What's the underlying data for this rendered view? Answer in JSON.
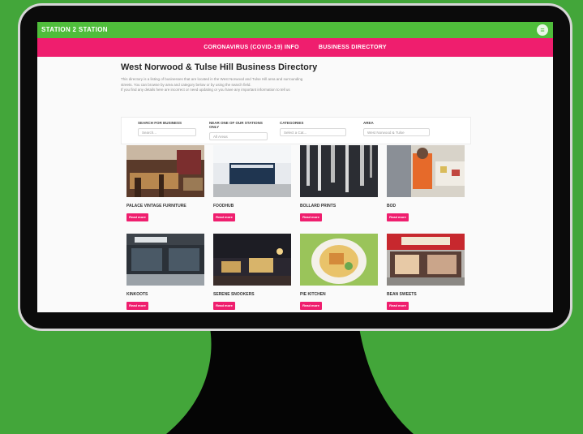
{
  "site": {
    "logo": "STATION 2 STATION",
    "menu_icon": "hamburger-circle-icon",
    "nav": [
      "CORONAVIRUS (COVID-19) INFO",
      "BUSINESS DIRECTORY"
    ]
  },
  "page": {
    "title": "West Norwood & Tulse Hill Business Directory",
    "intro_lines": [
      "This directory is a listing of businesses that are located in the West Norwood and Tulse Hill area and surrounding",
      "streets. You can browse by area and category below or by using the search field.",
      "If you find any details here are incorrect or need updating or you have any important information to tell us"
    ]
  },
  "filters": [
    {
      "label": "SEARCH FOR BUSINESS",
      "placeholder": "Search..."
    },
    {
      "label": "NEAR ONE OF OUR STATIONS ONLY",
      "placeholder": "All Areas"
    },
    {
      "label": "CATEGORIES",
      "placeholder": "Select a Cat..."
    },
    {
      "label": "AREA",
      "placeholder": "West Norwood & Tulse"
    }
  ],
  "button_label": "Read more",
  "cards": [
    {
      "name": "PALACE VINTAGE FURNITURE"
    },
    {
      "name": "FOODHUB"
    },
    {
      "name": "BOLLARD PRINTS"
    },
    {
      "name": "BOD"
    },
    {
      "name": "KINKOOTS"
    },
    {
      "name": "SERENE SNOOKERS"
    },
    {
      "name": "PIE KITCHEN"
    },
    {
      "name": "BEAN SWEETS"
    }
  ],
  "colors": {
    "background": "#43a63a",
    "header_green": "#4fbd3b",
    "accent_pink": "#ef1e6e"
  }
}
